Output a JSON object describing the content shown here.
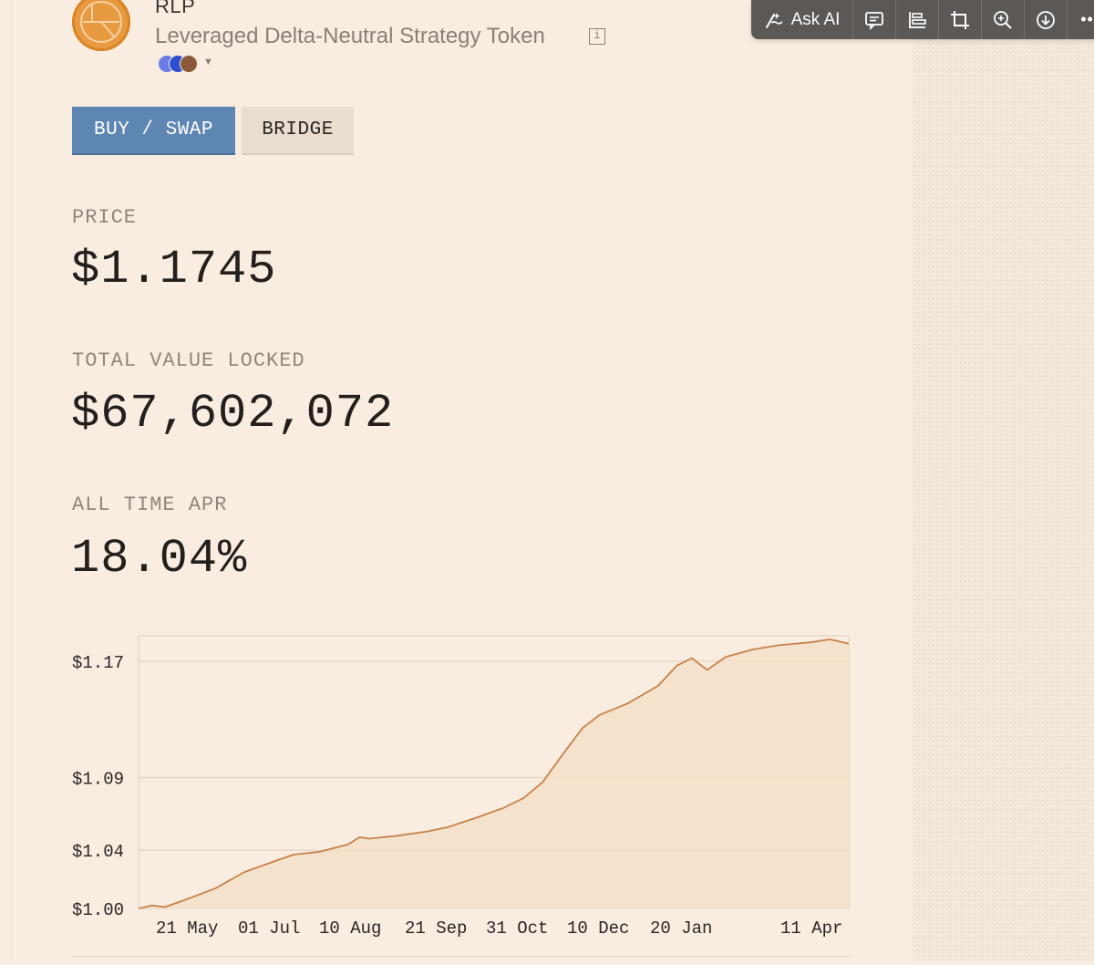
{
  "token": {
    "ticker": "RLP",
    "name": "Leveraged Delta-Neutral Strategy Token",
    "info_glyph": "i",
    "chains": [
      "ethereum-icon",
      "arbitrum-icon",
      "bitcoin-icon"
    ]
  },
  "toolbar": {
    "ask_ai_label": "Ask AI",
    "items": [
      "sparkle-icon",
      "comment-icon",
      "align-icon",
      "crop-icon",
      "zoom-in-icon",
      "download-icon",
      "more-icon"
    ],
    "more_label": "••"
  },
  "actions": {
    "buy_label": "BUY / SWAP",
    "bridge_label": "BRIDGE"
  },
  "stats": {
    "price_label": "PRICE",
    "price_value": "$1.1745",
    "tvl_label": "TOTAL VALUE LOCKED",
    "tvl_value": "$67,602,072",
    "apr_label": "ALL TIME APR",
    "apr_value": "18.04%"
  },
  "colors": {
    "accent_blue": "#5e86b3",
    "line": "#c7824a",
    "area": "#f4dfc8",
    "background": "#f9ede1"
  },
  "chart_data": {
    "type": "area",
    "ytick_labels": [
      "$1.17",
      "$1.09",
      "$1.04",
      "$1.00"
    ],
    "yticks": [
      1.17,
      1.09,
      1.04,
      1.0
    ],
    "xtick_labels": [
      "21 May",
      "01 Jul",
      "10 Aug",
      "21 Sep",
      "31 Oct",
      "10 Dec",
      "20 Jan",
      "11 Apr"
    ],
    "ylim": [
      1.0,
      1.1875
    ],
    "x": [
      "2024-04-10",
      "2024-04-17",
      "2024-04-24",
      "2024-05-05",
      "2024-05-21",
      "2024-06-05",
      "2024-06-20",
      "2024-07-01",
      "2024-07-15",
      "2024-07-30",
      "2024-08-05",
      "2024-08-10",
      "2024-08-25",
      "2024-09-10",
      "2024-09-21",
      "2024-10-05",
      "2024-10-20",
      "2024-10-31",
      "2024-11-10",
      "2024-11-20",
      "2024-12-01",
      "2024-12-10",
      "2024-12-25",
      "2025-01-10",
      "2025-01-20",
      "2025-01-28",
      "2025-02-05",
      "2025-02-15",
      "2025-03-01",
      "2025-03-15",
      "2025-04-01",
      "2025-04-11",
      "2025-04-18",
      "2025-04-21"
    ],
    "values": [
      1.0,
      1.002,
      1.001,
      1.006,
      1.014,
      1.025,
      1.032,
      1.037,
      1.039,
      1.044,
      1.049,
      1.048,
      1.05,
      1.053,
      1.056,
      1.062,
      1.069,
      1.076,
      1.087,
      1.105,
      1.124,
      1.133,
      1.141,
      1.153,
      1.167,
      1.172,
      1.164,
      1.173,
      1.178,
      1.181,
      1.183,
      1.185,
      1.183,
      1.182
    ]
  }
}
